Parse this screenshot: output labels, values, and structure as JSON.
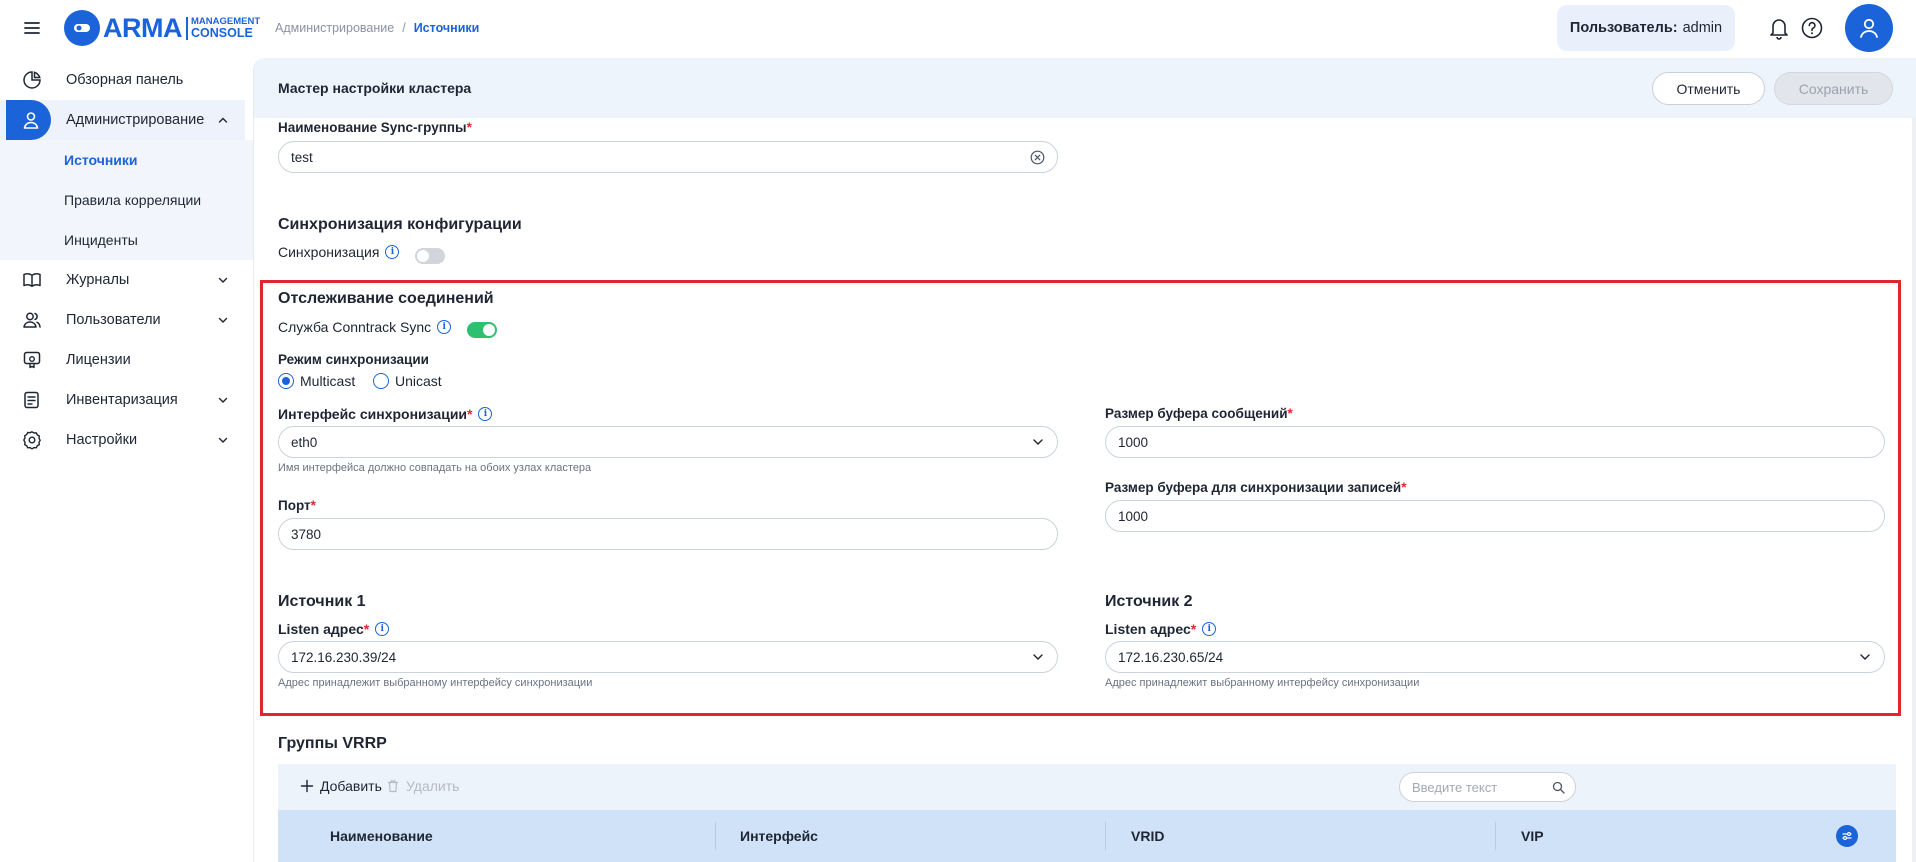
{
  "header": {
    "logo_main": "ARMA",
    "logo_sub1": "MANAGEMENT",
    "logo_sub2": "CONSOLE",
    "breadcrumb": [
      "Администрирование",
      "/",
      "Источники"
    ],
    "user_label": "Пользователь:",
    "user_name": "admin"
  },
  "sidebar": {
    "items": [
      {
        "label": "Обзорная панель"
      },
      {
        "label": "Администрирование"
      },
      {
        "label": "Журналы"
      },
      {
        "label": "Пользователи"
      },
      {
        "label": "Лицензии"
      },
      {
        "label": "Инвентаризация"
      },
      {
        "label": "Настройки"
      }
    ],
    "subitems": [
      {
        "label": "Источники"
      },
      {
        "label": "Правила корреляции"
      },
      {
        "label": "Инциденты"
      }
    ]
  },
  "panel": {
    "title": "Мастер настройки кластера",
    "cancel_label": "Отменить",
    "save_label": "Сохранить"
  },
  "form": {
    "sync_group_label": "Наименование Sync-группы",
    "sync_group_value": "test",
    "config_sync_title": "Синхронизация конфигурации",
    "config_sync_toggle_label": "Синхронизация",
    "config_sync_on": false,
    "conntrack_title": "Отслеживание соединений",
    "conntrack_toggle_label": "Служба Conntrack Sync",
    "conntrack_on": true,
    "sync_mode_label": "Режим синхронизации",
    "mode_multicast": "Multicast",
    "mode_unicast": "Unicast",
    "mode_selected": "Multicast",
    "interface_label": "Интерфейс синхронизации",
    "interface_value": "eth0",
    "interface_hint": "Имя интерфейса должно совпадать на обоих узлах кластера",
    "port_label": "Порт",
    "port_value": "3780",
    "msg_buffer_label": "Размер буфера сообщений",
    "msg_buffer_value": "1000",
    "rec_buffer_label": "Размер буфера для синхронизации записей",
    "rec_buffer_value": "1000",
    "source1_title": "Источник 1",
    "source1_listen_label": "Listen адрес",
    "source1_listen_value": "172.16.230.39/24",
    "source1_hint": "Адрес принадлежит выбранному интерфейсу синхронизации",
    "source2_title": "Источник 2",
    "source2_listen_label": "Listen адрес",
    "source2_listen_value": "172.16.230.65/24",
    "source2_hint": "Адрес принадлежит выбранному интерфейсу синхронизации",
    "required_mark": "*",
    "info_glyph": "i"
  },
  "vrrp": {
    "title": "Группы VRRP",
    "add_label": "Добавить",
    "delete_label": "Удалить",
    "search_placeholder": "Введите текст",
    "columns": [
      "Наименование",
      "Интерфейс",
      "VRID",
      "VIP"
    ]
  },
  "colors": {
    "accent": "#1a63d8",
    "highlight_border": "#e0262f",
    "toggle_on": "#2fbf71"
  }
}
